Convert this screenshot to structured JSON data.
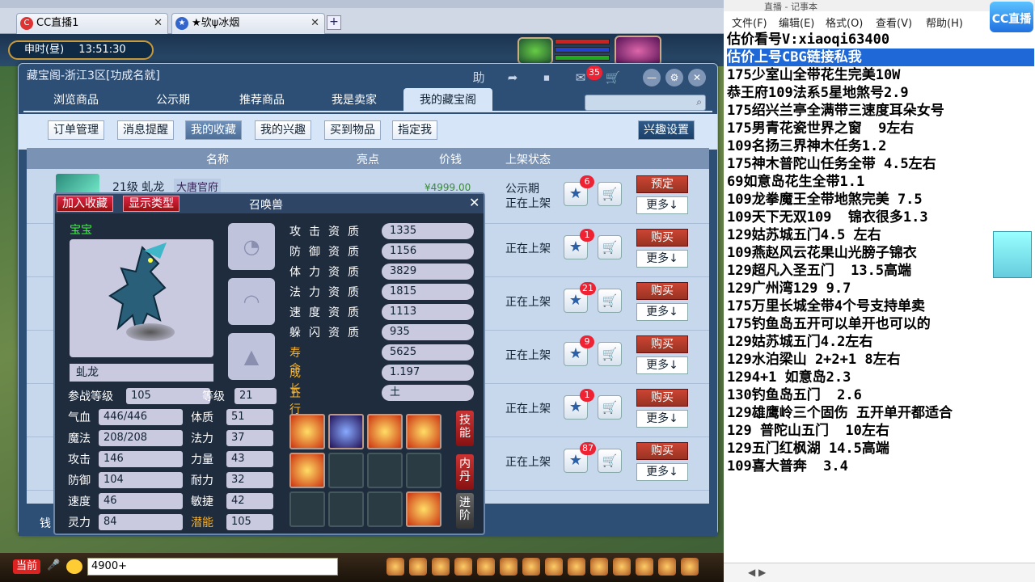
{
  "browser": {
    "tabs": [
      {
        "label": "CC直播1",
        "icon": "cc-icon"
      },
      {
        "label": "★欤ψ冰烟",
        "icon": "game-icon"
      }
    ],
    "new_tab": "+"
  },
  "game": {
    "clock_period": "申时(昼)",
    "clock_time": "13:51:30"
  },
  "store": {
    "title": "藏宝阁-浙江3区[功成名就]",
    "help": "助",
    "message_count": "35",
    "tabs": [
      "浏览商品",
      "公示期",
      "推荐商品",
      "我是卖家",
      "我的藏宝阁"
    ],
    "active_tab": "我的藏宝阁",
    "subnav": [
      "订单管理",
      "消息提醒",
      "我的收藏",
      "我的兴趣",
      "买到物品",
      "指定我"
    ],
    "subnav_active": "我的收藏",
    "interest_settings": "兴趣设置",
    "columns": {
      "name": "名称",
      "highlight": "亮点",
      "price": "价钱",
      "status": "上架状态"
    },
    "rows": [
      {
        "level": "21级",
        "name": "虬龙",
        "tag": "大唐官府",
        "price": "¥4999.00",
        "status_line1": "公示期",
        "status_line2": "正在上架",
        "stars": "6",
        "action": "预定",
        "more": "更多↓"
      },
      {
        "status_line1": "正在上架",
        "stars": "1",
        "action": "购买",
        "more": "更多↓"
      },
      {
        "status_line1": "正在上架",
        "stars": "21",
        "action": "购买",
        "more": "更多↓"
      },
      {
        "status_line1": "正在上架",
        "stars": "9",
        "action": "购买",
        "more": "更多↓"
      },
      {
        "status_line1": "正在上架",
        "stars": "1",
        "action": "购买",
        "more": "更多↓"
      },
      {
        "status_line1": "正在上架",
        "stars": "87",
        "action": "购买",
        "more": "更多↓"
      }
    ],
    "bottom_text": "钱"
  },
  "pet": {
    "add_fav": "加入收藏",
    "show_type": "显示类型",
    "title": "召唤兽",
    "close": "✕",
    "kind_label": "宝宝",
    "name": "虬龙",
    "qualities": [
      {
        "label": "攻击资质",
        "value": "1335"
      },
      {
        "label": "防御资质",
        "value": "1156"
      },
      {
        "label": "体力资质",
        "value": "3829"
      },
      {
        "label": "法力资质",
        "value": "1815"
      },
      {
        "label": "速度资质",
        "value": "1113"
      },
      {
        "label": "躲闪资质",
        "value": "935"
      }
    ],
    "life_label": "寿命",
    "life": "5625",
    "growth_label": "成长",
    "growth": "1.197",
    "element_label": "五行",
    "element": "土",
    "battle_level_label": "参战等级",
    "battle_level": "105",
    "level_label": "等级",
    "level": "21",
    "stats_left": [
      {
        "label": "气血",
        "value": "446/446"
      },
      {
        "label": "魔法",
        "value": "208/208"
      },
      {
        "label": "攻击",
        "value": "146"
      },
      {
        "label": "防御",
        "value": "104"
      },
      {
        "label": "速度",
        "value": "46"
      },
      {
        "label": "灵力",
        "value": "84"
      }
    ],
    "stats_right": [
      {
        "label": "体质",
        "value": "51"
      },
      {
        "label": "法力",
        "value": "37"
      },
      {
        "label": "力量",
        "value": "43"
      },
      {
        "label": "耐力",
        "value": "32"
      },
      {
        "label": "敏捷",
        "value": "42"
      },
      {
        "label": "潜能",
        "value": "105"
      }
    ],
    "side_tabs": [
      "技能",
      "内丹",
      "进阶"
    ]
  },
  "chat": {
    "channel": "当前",
    "input_value": "4900+"
  },
  "notepad": {
    "title_fragment": "直播 - 记事本",
    "menu": [
      "文件(F)",
      "编辑(E)",
      "格式(O)",
      "查看(V)",
      "帮助(H)"
    ],
    "lines": [
      "估价看号V:xiaoqi63400",
      "估价上号CBG链接私我",
      "175少室山全带花生完美10W",
      "恭王府109法系5星地煞号2.9",
      "175绍兴兰亭全满带三速度耳朵女号",
      "175男青花瓷世界之窗  9左右",
      "109名扬三界神木任务1.2",
      "175神木普陀山任务全带 4.5左右",
      "69如意岛花生全带1.1",
      "109龙拳魔王全带地煞完美 7.5",
      "109天下无双109  锦衣很多1.3",
      "129姑苏城五门4.5 左右",
      "109燕赵风云花果山光膀子锦衣",
      "129超凡入圣五门  13.5高端",
      "129广州湾129 9.7",
      "175万里长城全带4个号支持单卖",
      "175钓鱼岛五开可以单开也可以的",
      "129姑苏城五门4.2左右",
      "129水泊梁山 2+2+1 8左右",
      "1294+1 如意岛2.3",
      "130钓鱼岛五门  2.6",
      "129雄鹰岭三个固伤 五开单开都适合",
      "129 普陀山五门  10左右",
      "129五门红枫湖 14.5高端",
      "109喜大普奔  3.4"
    ],
    "highlight_line": 1,
    "logo": "CC直播"
  }
}
